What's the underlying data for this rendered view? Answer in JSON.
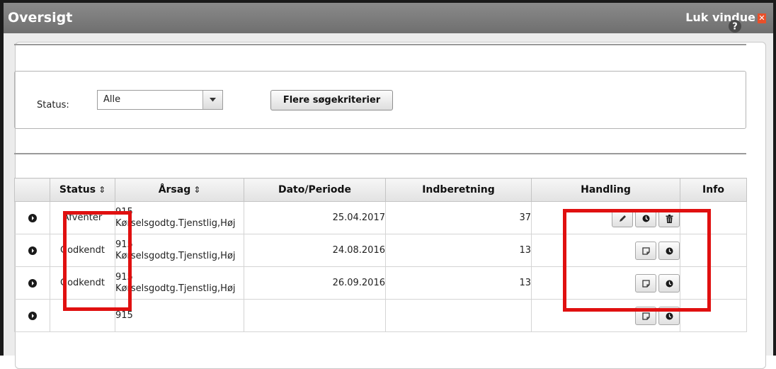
{
  "window": {
    "title": "Oversigt",
    "close_label": "Luk vindue"
  },
  "icons": {
    "help": "help-icon",
    "dropdown": "chevron-down-icon",
    "expand": "expand-icon",
    "edit": "pencil-icon",
    "history": "clock-icon",
    "delete": "trash-icon",
    "note": "note-icon"
  },
  "filter": {
    "status_label": "Status:",
    "status_value": "Alle",
    "more_criteria": "Flere søgekriterier"
  },
  "table": {
    "headers": {
      "status": "Status",
      "arsag": "Årsag",
      "dato": "Dato/Periode",
      "indberetning": "Indberetning",
      "handling": "Handling",
      "info": "Info"
    },
    "sort_glyph": "⇕",
    "rows": [
      {
        "status": "Afventer",
        "arsag_code": "915",
        "arsag_text": "Kørselsgodtg.Tjenstlig,Høj",
        "dato": "25.04.2017",
        "indberetning": "37",
        "actions": [
          "edit",
          "history",
          "delete"
        ]
      },
      {
        "status": "Godkendt",
        "arsag_code": "915",
        "arsag_text": "Kørselsgodtg.Tjenstlig,Høj",
        "dato": "24.08.2016",
        "indberetning": "13",
        "actions": [
          "note",
          "history"
        ]
      },
      {
        "status": "Godkendt",
        "arsag_code": "915",
        "arsag_text": "Kørselsgodtg.Tjenstlig,Høj",
        "dato": "26.09.2016",
        "indberetning": "13",
        "actions": [
          "note",
          "history"
        ]
      },
      {
        "status": "",
        "arsag_code": "915",
        "arsag_text": "",
        "dato": "",
        "indberetning": "",
        "actions": [
          "note",
          "history"
        ]
      }
    ]
  },
  "colors": {
    "titlebar": "#7a7a7a",
    "highlight": "#e01010",
    "close_accent": "#e8502a"
  }
}
